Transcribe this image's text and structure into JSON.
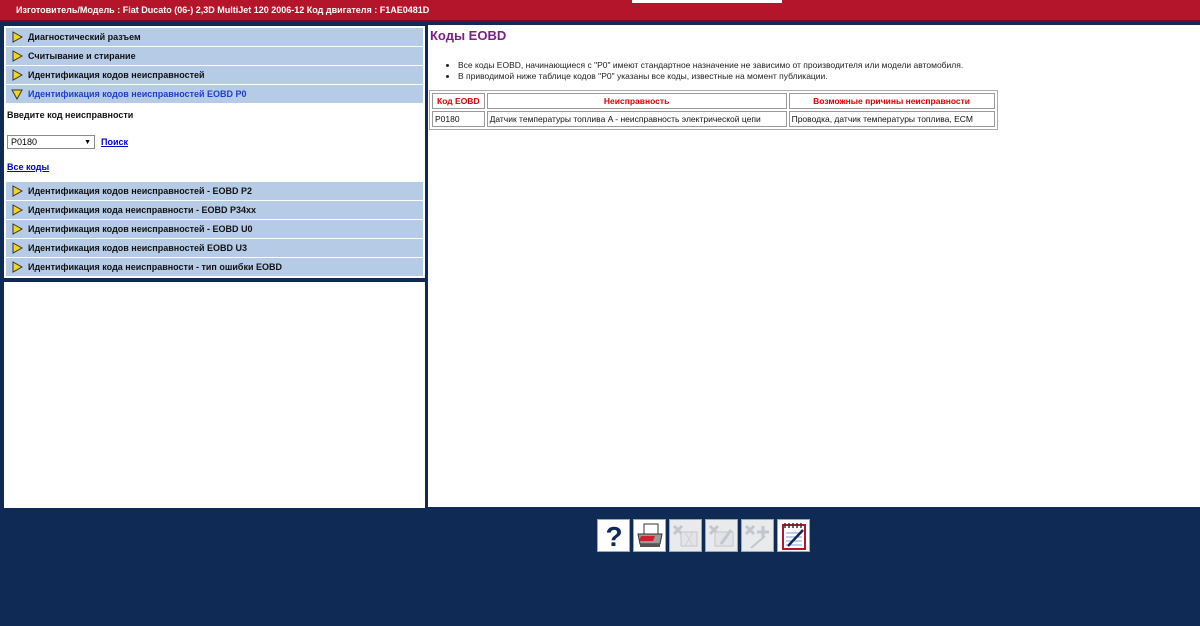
{
  "header": {
    "title": "Изготовитель/Модель : Fiat Ducato (06-) 2,3D MultiJet 120 2006-12  Код двигателя : F1AE0481D"
  },
  "menu_top": [
    {
      "label": "Диагностический разъем",
      "active": false
    },
    {
      "label": "Считывание и стирание",
      "active": false
    },
    {
      "label": "Идентификация кодов неисправностей",
      "active": false
    },
    {
      "label": "Идентификация кодов неисправностей EOBD P0",
      "active": true
    }
  ],
  "search": {
    "label": "Введите код неисправности",
    "selected_code": "P0180",
    "search_link": "Поиск",
    "all_codes_link": "Все коды"
  },
  "menu_bottom": [
    {
      "label": "Идентификация кодов неисправностей - EOBD P2"
    },
    {
      "label": "Идентификация кода неисправности - EOBD P34xx"
    },
    {
      "label": "Идентификация кодов неисправностей - EOBD U0"
    },
    {
      "label": "Идентификация кодов неисправностей EOBD U3"
    },
    {
      "label": "Идентификация кода неисправности - тип ошибки EOBD"
    }
  ],
  "content": {
    "heading": "Коды EOBD",
    "bullets": [
      "Все коды EOBD, начинающиеся с \"P0\" имеют стандартное назначение не зависимо от производителя или модели автомобиля.",
      "В приводимой ниже таблице кодов \"P0\" указаны все коды, известные на момент публикации."
    ],
    "table": {
      "headers": [
        "Код EOBD",
        "Неисправность",
        "Возможные причины неисправности"
      ],
      "rows": [
        [
          "P0180",
          "Датчик температуры топлива A - неисправность электрической цепи",
          "Проводка, датчик температуры топлива, ECM"
        ]
      ]
    }
  },
  "toolbar": [
    {
      "icon": "help-icon",
      "enabled": true
    },
    {
      "icon": "print-icon",
      "enabled": true
    },
    {
      "icon": "delete-disabled-icon",
      "enabled": false
    },
    {
      "icon": "edit-disabled-icon",
      "enabled": false
    },
    {
      "icon": "add-disabled-icon",
      "enabled": false
    },
    {
      "icon": "notepad-icon",
      "enabled": true
    }
  ],
  "colors": {
    "header_red": "#b5152b",
    "background_navy": "#0f2a55",
    "menu_blue": "#b6cbe6",
    "heading_purple": "#7b1f86",
    "table_header_red": "#dd0000"
  }
}
